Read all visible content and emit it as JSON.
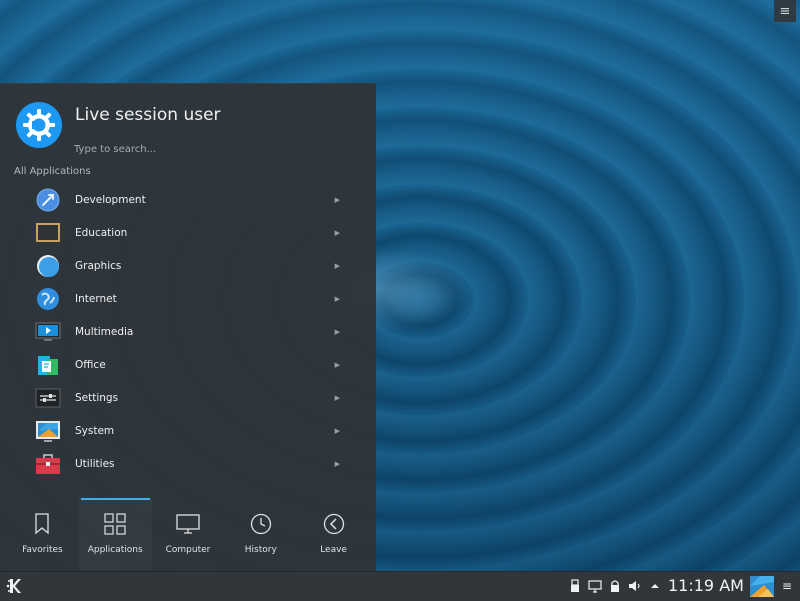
{
  "launcher": {
    "user_name": "Live session user",
    "search_placeholder": "Type to search...",
    "section_label": "All Applications",
    "categories": [
      {
        "label": "Development",
        "icon": "development-icon"
      },
      {
        "label": "Education",
        "icon": "education-icon"
      },
      {
        "label": "Graphics",
        "icon": "graphics-icon"
      },
      {
        "label": "Internet",
        "icon": "internet-icon"
      },
      {
        "label": "Multimedia",
        "icon": "multimedia-icon"
      },
      {
        "label": "Office",
        "icon": "office-icon"
      },
      {
        "label": "Settings",
        "icon": "settings-icon"
      },
      {
        "label": "System",
        "icon": "system-icon"
      },
      {
        "label": "Utilities",
        "icon": "utilities-icon"
      }
    ],
    "tabs": [
      {
        "label": "Favorites",
        "icon": "bookmark-icon"
      },
      {
        "label": "Applications",
        "icon": "grid-icon",
        "active": true
      },
      {
        "label": "Computer",
        "icon": "monitor-icon"
      },
      {
        "label": "History",
        "icon": "clock-icon"
      },
      {
        "label": "Leave",
        "icon": "back-arrow-icon"
      }
    ]
  },
  "panel": {
    "clock": "11:19 AM"
  },
  "colors": {
    "accent": "#3daee9",
    "panel_bg": "#31363b",
    "launcher_bg": "#2f3438",
    "avatar": "#1d99f3"
  }
}
